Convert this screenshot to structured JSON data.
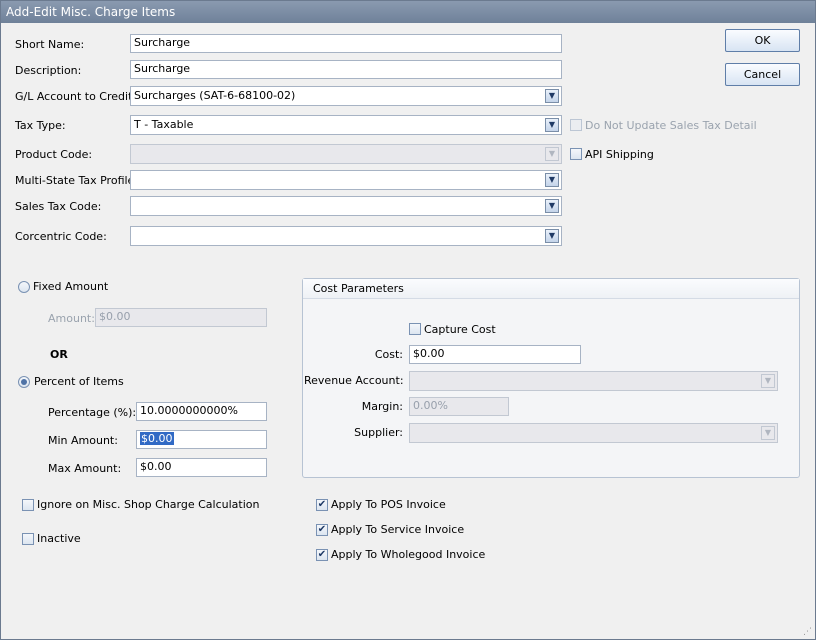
{
  "window": {
    "title": "Add-Edit Misc. Charge Items"
  },
  "buttons": {
    "ok": "OK",
    "cancel": "Cancel"
  },
  "fields": {
    "short_name": {
      "label": "Short Name:",
      "value": "Surcharge"
    },
    "description": {
      "label": "Description:",
      "value": "Surcharge"
    },
    "gl_account": {
      "label": "G/L Account to Credit:",
      "value": "Surcharges (SAT-6-68100-02)"
    },
    "tax_type": {
      "label": "Tax Type:",
      "value": "T - Taxable"
    },
    "product_code": {
      "label": "Product Code:",
      "value": ""
    },
    "multi_state_tax_profile": {
      "label": "Multi-State Tax Profile:",
      "value": ""
    },
    "sales_tax_code": {
      "label": "Sales Tax Code:",
      "value": ""
    },
    "corcentric_code": {
      "label": "Corcentric Code:",
      "value": ""
    }
  },
  "side_checks": {
    "do_not_update_sales_tax": {
      "label": "Do Not Update Sales Tax Detail",
      "checked": false,
      "enabled": false
    },
    "api_shipping": {
      "label": "API Shipping",
      "checked": false
    }
  },
  "amount_mode": {
    "fixed_label": "Fixed Amount",
    "amount_label": "Amount:",
    "amount_value": "$0.00",
    "or_label": "OR",
    "percent_label": "Percent of Items",
    "selected": "percent",
    "percentage_label": "Percentage (%):",
    "percentage_value": "10.0000000000%",
    "min_label": "Min Amount:",
    "min_value": "$0.00",
    "max_label": "Max Amount:",
    "max_value": "$0.00"
  },
  "cost_parameters": {
    "title": "Cost Parameters",
    "capture_cost_label": "Capture Cost",
    "capture_cost_checked": false,
    "cost_label": "Cost:",
    "cost_value": "$0.00",
    "revenue_account_label": "Revenue Account:",
    "revenue_account_value": "",
    "margin_label": "Margin:",
    "margin_value": "0.00%",
    "supplier_label": "Supplier:",
    "supplier_value": ""
  },
  "bottom_checks": {
    "ignore_misc_shop": {
      "label": "Ignore on Misc. Shop Charge Calculation",
      "checked": false
    },
    "inactive": {
      "label": "Inactive",
      "checked": false
    },
    "apply_pos": {
      "label": "Apply To POS Invoice",
      "checked": true
    },
    "apply_service": {
      "label": "Apply To Service Invoice",
      "checked": true
    },
    "apply_wholegood": {
      "label": "Apply To Wholegood Invoice",
      "checked": true
    }
  },
  "icons": {
    "dropdown": "chevron-down-icon",
    "check": "check-icon",
    "resize": "resize-grip-icon"
  },
  "colors": {
    "titlebar": "#7a8aa3",
    "selection": "#316ac5"
  }
}
